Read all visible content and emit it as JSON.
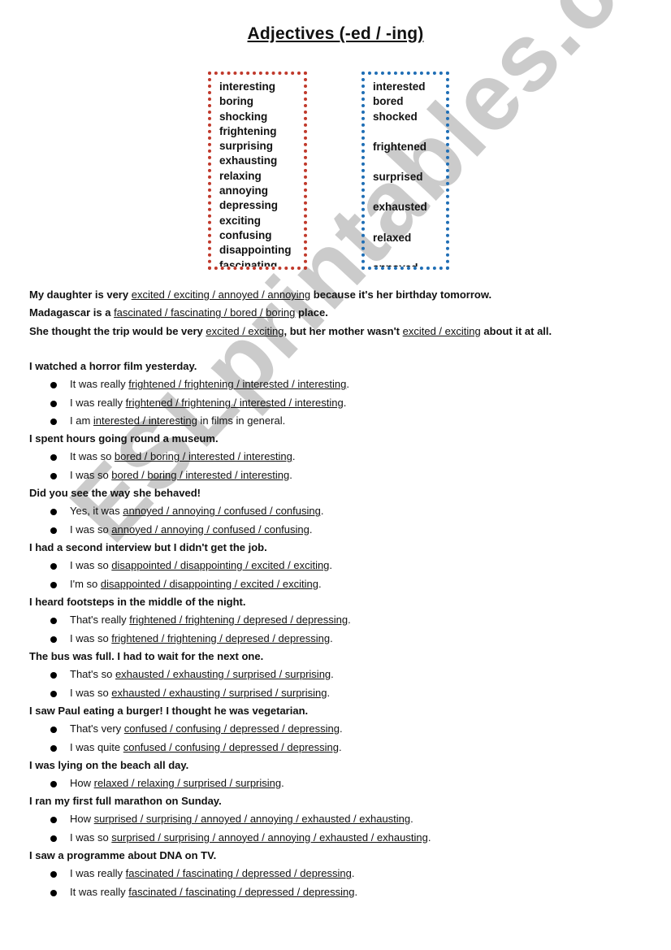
{
  "title": "Adjectives (-ed / -ing)",
  "watermark": "ESLprintables.com",
  "colors": {
    "ing_box_border": "#c0392b",
    "ed_box_border": "#1f6eb5"
  },
  "ing_words": [
    "interesting",
    "boring",
    "shocking",
    "frightening",
    "surprising",
    "exhausting",
    "relaxing",
    "annoying",
    "depressing",
    "exciting",
    "confusing",
    "disappointing",
    "fascinating"
  ],
  "ed_words": [
    "interested",
    "bored",
    "shocked",
    "frightened",
    "surprised",
    "exhausted",
    "relaxed",
    "annoyed"
  ],
  "intro_sentences": [
    {
      "before": "My daughter is very ",
      "options": "excited / exciting / annoyed / annoying",
      "after": " because it's her birthday tomorrow."
    },
    {
      "before": "Madagascar is a ",
      "options": "fascinated / fascinating / bored / boring",
      "after": " place."
    },
    {
      "before": "She thought the trip would be very ",
      "options": "excited / exciting",
      "middle": ", but her mother wasn't ",
      "options2": "excited / exciting",
      "after": " about it at all."
    }
  ],
  "sections": [
    {
      "heading": "I watched a horror film yesterday.",
      "items": [
        {
          "before": "It was really ",
          "options": "frightened / frightening / interested / interesting",
          "after": "."
        },
        {
          "before": "I was really ",
          "options": "frightened / frightening / interested / interesting",
          "after": "."
        },
        {
          "before": "I am ",
          "options": "interested / interesting",
          "after": " in films in general."
        }
      ]
    },
    {
      "heading": "I spent hours going round a museum.",
      "items": [
        {
          "before": "It was so ",
          "options": "bored / boring / interested / interesting",
          "after": "."
        },
        {
          "before": "I was so ",
          "options": "bored / boring / interested / interesting",
          "after": "."
        }
      ]
    },
    {
      "heading": "Did you see the way she behaved!",
      "items": [
        {
          "before": "Yes, it was ",
          "options": "annoyed / annoying / confused / confusing",
          "after": "."
        },
        {
          "before": "I was so ",
          "options": "annoyed / annoying / confused / confusing",
          "after": "."
        }
      ]
    },
    {
      "heading": "I had a second interview but I didn't get the job.",
      "items": [
        {
          "before": "I was so ",
          "options": "disappointed / disappointing / excited / exciting",
          "after": "."
        },
        {
          "before": "I'm so ",
          "options": "disappointed / disappointing / excited / exciting",
          "after": "."
        }
      ]
    },
    {
      "heading": "I heard footsteps in the middle of the night.",
      "items": [
        {
          "before": "That's really ",
          "options": "frightened / frightening / depresed / depressing",
          "after": "."
        },
        {
          "before": "I was so ",
          "options": "frightened / frightening / depresed / depressing",
          "after": "."
        }
      ]
    },
    {
      "heading": "The bus was full. I had to wait for the next one.",
      "items": [
        {
          "before": "That's so ",
          "options": "exhausted / exhausting / surprised / surprising",
          "after": "."
        },
        {
          "before": "I was so ",
          "options": "exhausted / exhausting / surprised / surprising",
          "after": "."
        }
      ]
    },
    {
      "heading": "I saw Paul eating a burger! I thought he was vegetarian.",
      "items": [
        {
          "before": "That's very ",
          "options": "confused / confusing / depressed / depressing",
          "after": "."
        },
        {
          "before": "I was quite ",
          "options": "confused / confusing / depressed / depressing",
          "after": "."
        }
      ]
    },
    {
      "heading": "I was lying on the beach all day.",
      "items": [
        {
          "before": "How ",
          "options": "relaxed / relaxing / surprised / surprising",
          "after": "."
        }
      ]
    },
    {
      "heading": "I ran my first full marathon on Sunday.",
      "items": [
        {
          "before": "How ",
          "options": "surprised / surprising / annoyed / annoying / exhausted / exhausting",
          "after": "."
        },
        {
          "before": "I was so ",
          "options": "surprised / surprising / annoyed / annoying / exhausted / exhausting",
          "after": "."
        }
      ]
    },
    {
      "heading": "I saw a programme about DNA on TV.",
      "items": [
        {
          "before": "I was really ",
          "options": "fascinated / fascinating / depressed / depressing",
          "after": "."
        },
        {
          "before": "It was really ",
          "options": "fascinated / fascinating / depressed / depressing",
          "after": "."
        }
      ]
    }
  ]
}
